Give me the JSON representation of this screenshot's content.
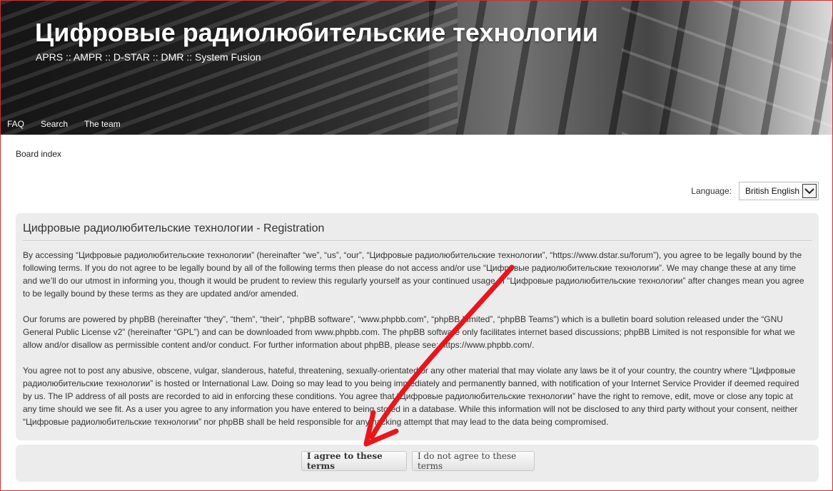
{
  "header": {
    "site_title": "Цифровые радиолюбительские технологии",
    "site_description": "APRS :: AMPR :: D-STAR :: DMR :: System Fusion",
    "nav": [
      {
        "label": "FAQ"
      },
      {
        "label": "Search"
      },
      {
        "label": "The team"
      }
    ]
  },
  "breadcrumb": {
    "board_index": "Board index"
  },
  "language": {
    "label": "Language:",
    "selected": "British English"
  },
  "registration": {
    "title": "Цифровые радиолюбительские технологии - Registration",
    "paragraphs": [
      "By accessing “Цифровые радиолюбительские технологии” (hereinafter “we”, “us”, “our”, “Цифровые радиолюбительские технологии”, “https://www.dstar.su/forum”), you agree to be legally bound by the following terms. If you do not agree to be legally bound by all of the following terms then please do not access and/or use “Цифровые радиолюбительские технологии”. We may change these at any time and we’ll do our utmost in informing you, though it would be prudent to review this regularly yourself as your continued usage of “Цифровые радиолюбительские технологии” after changes mean you agree to be legally bound by these terms as they are updated and/or amended.",
      "Our forums are powered by phpBB (hereinafter “they”, “them”, “their”, “phpBB software”, “www.phpbb.com”, “phpBB Limited”, “phpBB Teams”) which is a bulletin board solution released under the “GNU General Public License v2” (hereinafter “GPL”) and can be downloaded from www.phpbb.com. The phpBB software only facilitates internet based discussions; phpBB Limited is not responsible for what we allow and/or disallow as permissible content and/or conduct. For further information about phpBB, please see: https://www.phpbb.com/.",
      "You agree not to post any abusive, obscene, vulgar, slanderous, hateful, threatening, sexually-orientated or any other material that may violate any laws be it of your country, the country where “Цифровые радиолюбительские технологии” is hosted or International Law. Doing so may lead to you being immediately and permanently banned, with notification of your Internet Service Provider if deemed required by us. The IP address of all posts are recorded to aid in enforcing these conditions. You agree that “Цифровые радиолюбительские технологии” have the right to remove, edit, move or close any topic at any time should we see fit. As a user you agree to any information you have entered to being stored in a database. While this information will not be disclosed to any third party without your consent, neither “Цифровые радиолюбительские технологии” nor phpBB shall be held responsible for any hacking attempt that may lead to the data being compromised."
    ]
  },
  "buttons": {
    "agree": "I agree to these terms",
    "disagree": "I do not agree to these terms"
  },
  "annotation": {
    "arrow_color": "#e8161b"
  }
}
